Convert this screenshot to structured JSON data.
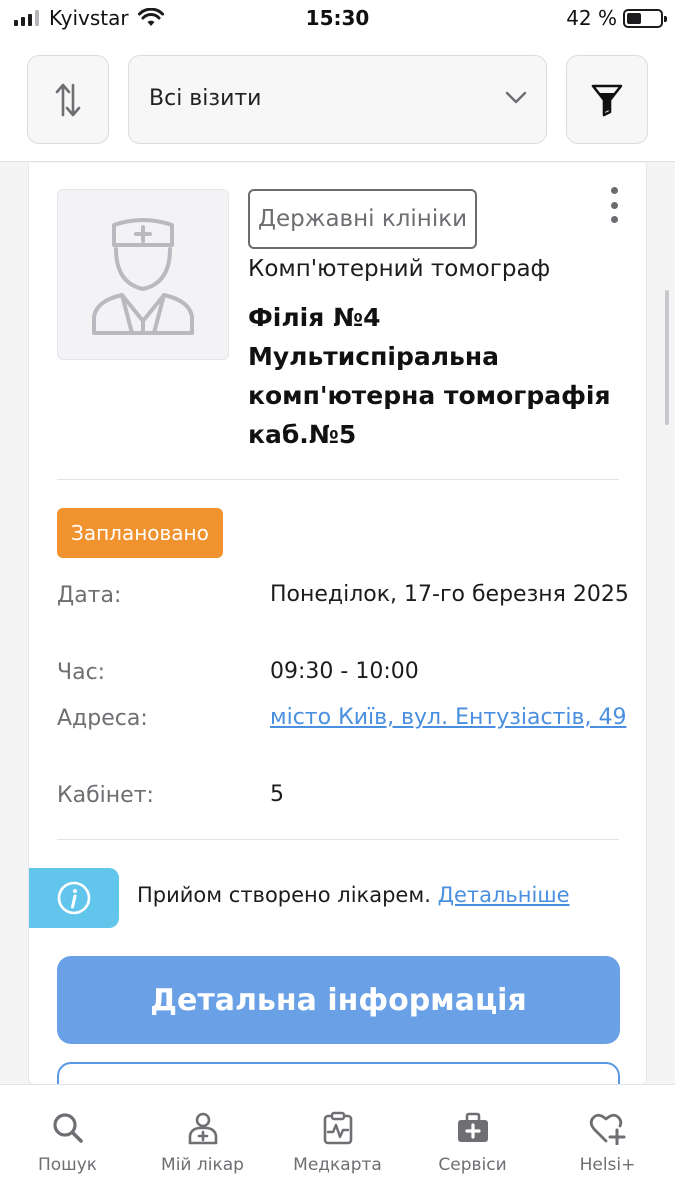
{
  "status_bar": {
    "carrier": "Kyivstar",
    "time": "15:30",
    "battery": "42 %"
  },
  "toolbar": {
    "sort_icon": "sort-arrows-icon",
    "filter_select": {
      "value": "Всі візити"
    },
    "filter_icon": "funnel-icon"
  },
  "visit": {
    "avatar_icon": "doctor-avatar-icon",
    "clinic_type": "Державні клініки",
    "specialty": "Комп'ютерний томограф",
    "clinic_name": "Філія №4 Мультиспіральна комп'ютерна томографія каб.№5",
    "status": "Заплановано",
    "status_color": "#f0922d",
    "details": [
      {
        "label": "Дата:",
        "value": "Понеділок, 17-го березня 2025"
      },
      {
        "label": "Час:",
        "value": "09:30 - 10:00"
      },
      {
        "label": "Адреса:",
        "value": "місто Київ, вул. Ентузіастів, 49"
      },
      {
        "label": "Кабінет:",
        "value": "5"
      }
    ],
    "note": "Прийом створено лікарем.",
    "note_link": "Детальніше",
    "detail_button": "Детальна інформація"
  },
  "tabbar": {
    "items": [
      {
        "label": "Пошук",
        "icon": "search-icon"
      },
      {
        "label": "Мій лікар",
        "icon": "doctor-icon"
      },
      {
        "label": "Медкарта",
        "icon": "medical-card-icon"
      },
      {
        "label": "Сервіси",
        "icon": "medkit-icon"
      },
      {
        "label": "Helsi+",
        "icon": "heart-plus-icon"
      }
    ]
  },
  "colors": {
    "accent_blue": "#6aa1e6",
    "link_blue": "#4a8fe0",
    "info_cyan": "#62c5ec",
    "status_orange": "#f0922d"
  }
}
